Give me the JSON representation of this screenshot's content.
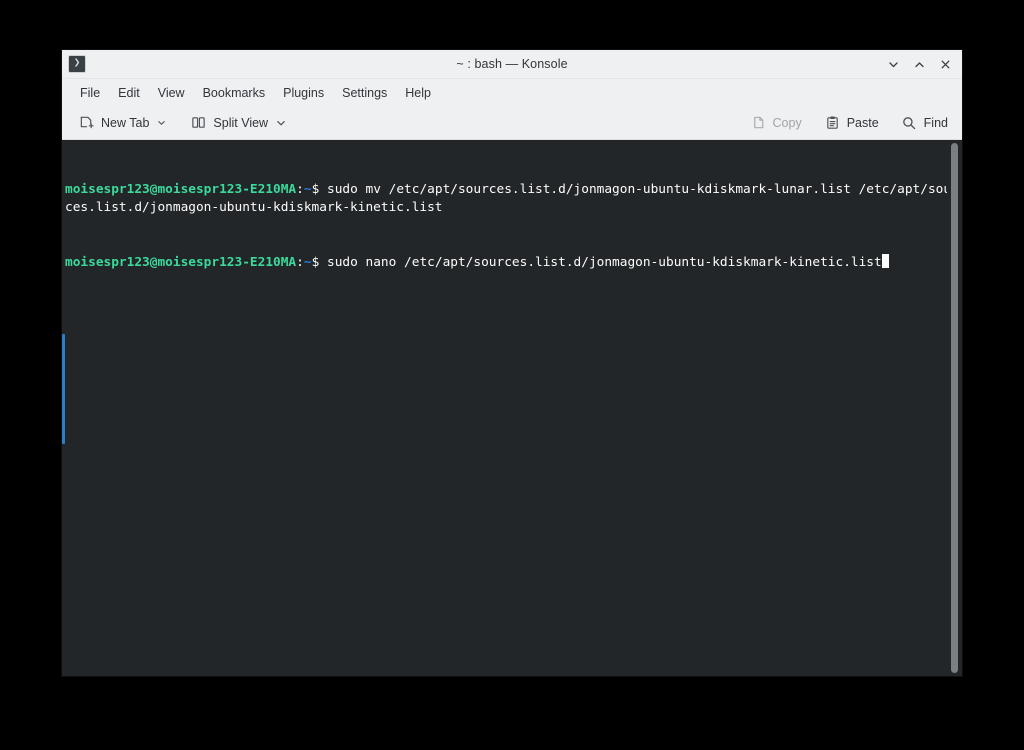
{
  "window": {
    "title": "~ : bash — Konsole",
    "app_icon": "terminal-prompt-icon",
    "icon_glyph": "❯",
    "controls": {
      "minimize": "minimize",
      "maximize": "maximize",
      "close": "close"
    }
  },
  "menubar": {
    "items": [
      {
        "label": "File"
      },
      {
        "label": "Edit"
      },
      {
        "label": "View"
      },
      {
        "label": "Bookmarks"
      },
      {
        "label": "Plugins"
      },
      {
        "label": "Settings"
      },
      {
        "label": "Help"
      }
    ]
  },
  "toolbar": {
    "new_tab": {
      "label": "New Tab",
      "icon": "new-tab-icon",
      "enabled": true
    },
    "split_view": {
      "label": "Split View",
      "icon": "split-view-icon",
      "enabled": true
    },
    "copy": {
      "label": "Copy",
      "icon": "copy-icon",
      "enabled": false
    },
    "paste": {
      "label": "Paste",
      "icon": "paste-icon",
      "enabled": true
    },
    "find": {
      "label": "Find",
      "icon": "search-icon",
      "enabled": true
    }
  },
  "terminal": {
    "background_color": "#232629",
    "foreground_color": "#fcfcfc",
    "prompt_user_color": "#3bd99b",
    "prompt_path_color": "#2a7bde",
    "lines": [
      {
        "type": "command",
        "prompt_user": "moisespr123@moisespr123-E210MA",
        "prompt_colon": ":",
        "prompt_path": "~",
        "prompt_sigil": "$ ",
        "command": "sudo mv /etc/apt/sources.list.d/jonmagon-ubuntu-kdiskmark-lunar.list /etc/apt/sources.list.d/jonmagon-ubuntu-kdiskmark-kinetic.list"
      },
      {
        "type": "command",
        "prompt_user": "moisespr123@moisespr123-E210MA",
        "prompt_colon": ":",
        "prompt_path": "~",
        "prompt_sigil": "$ ",
        "command": "sudo nano /etc/apt/sources.list.d/jonmagon-ubuntu-kdiskmark-kinetic.list",
        "cursor_after": true
      }
    ],
    "accent_bar_color": "#2980c9",
    "scrollbar": {
      "thumb_color": "#7b7f83"
    }
  }
}
